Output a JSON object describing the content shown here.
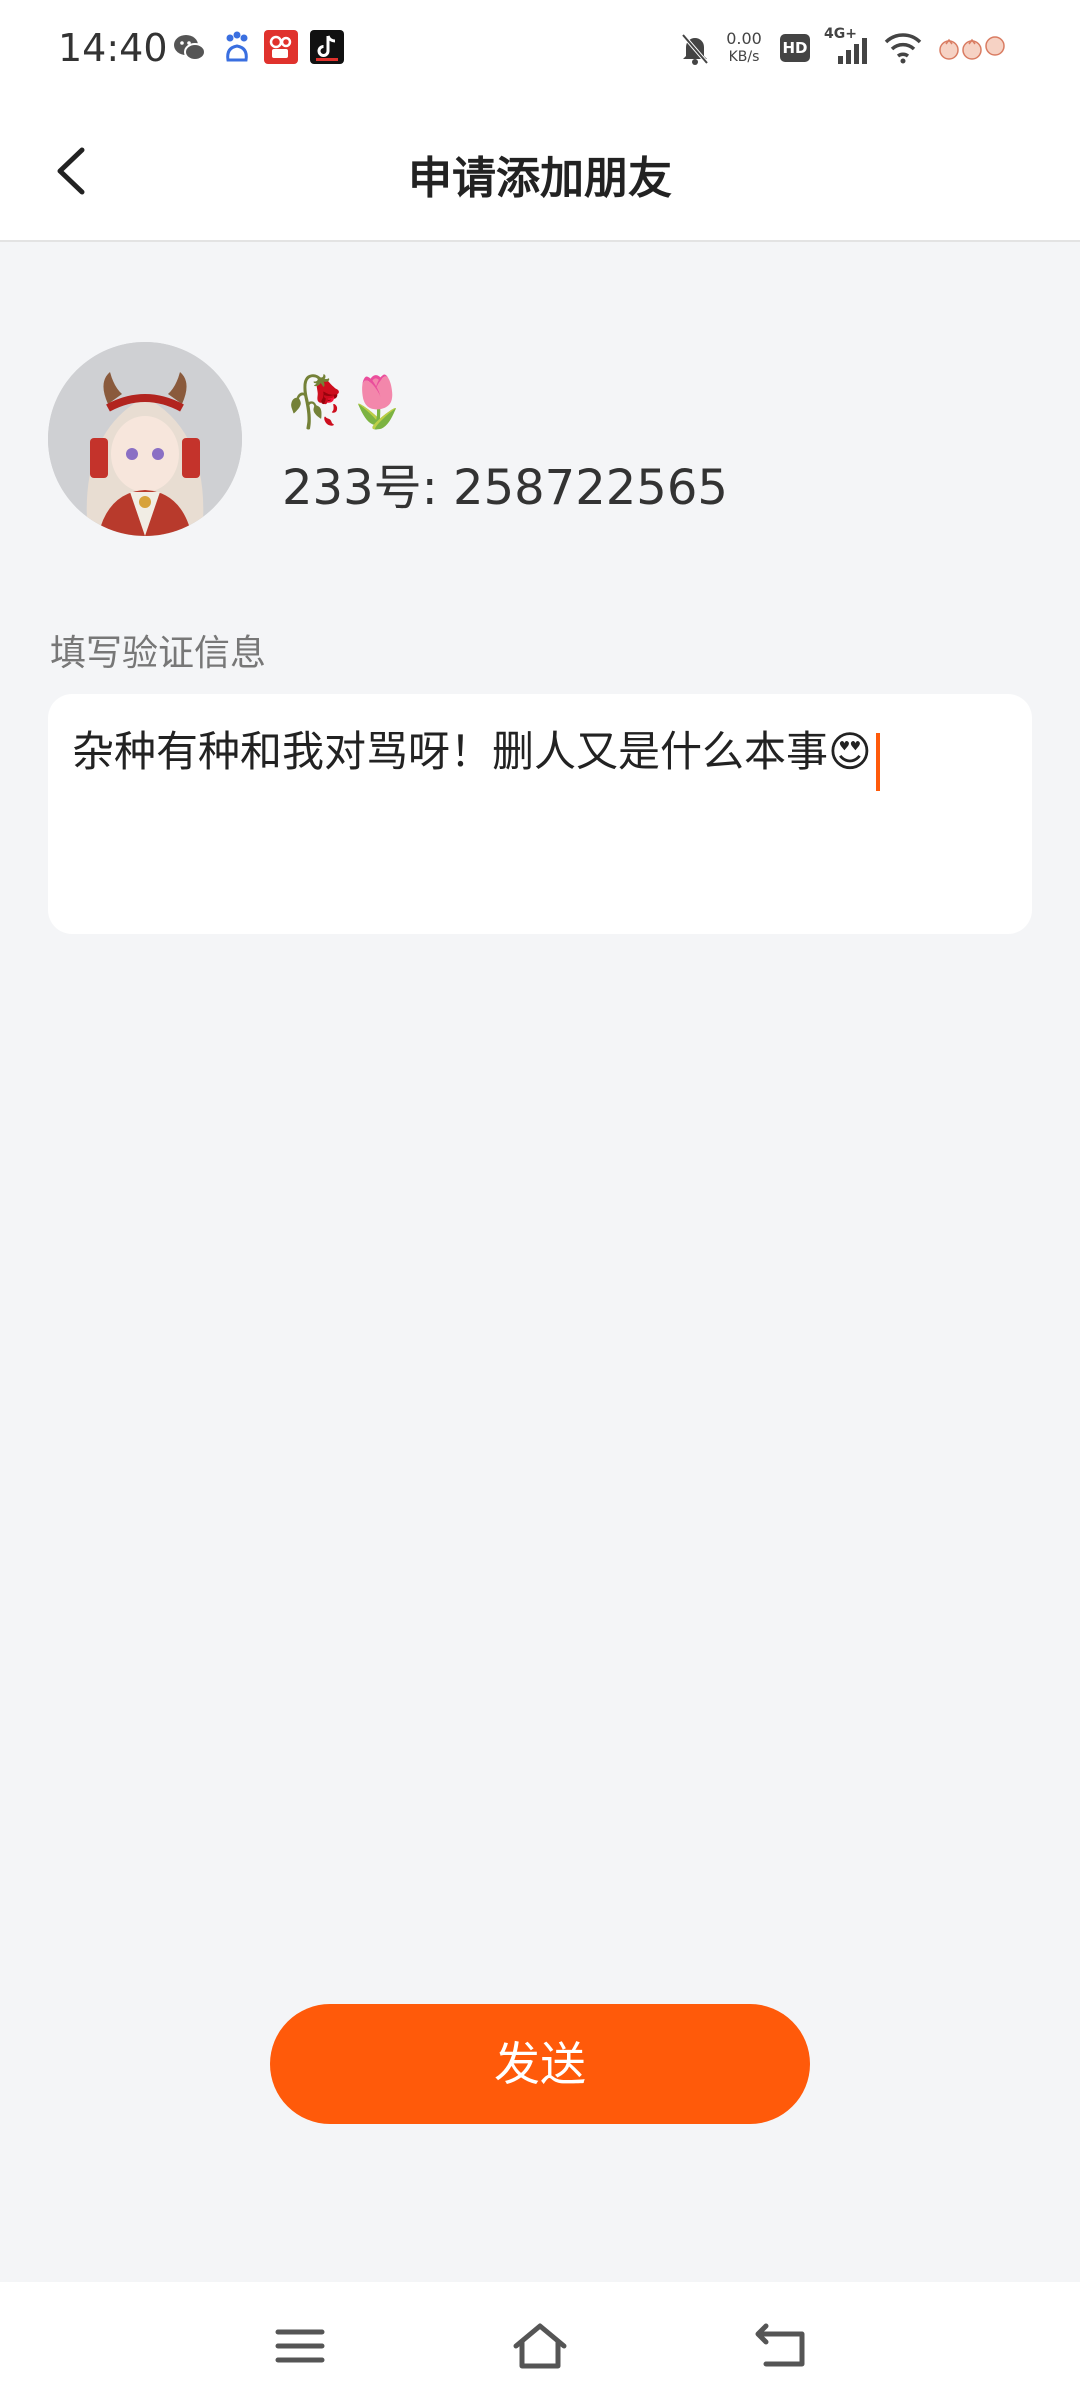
{
  "status_bar": {
    "time": "14:40",
    "net_speed_value": "0.00",
    "net_speed_unit": "KB/s",
    "hd_label": "HD",
    "network_label": "4G+",
    "app_icons": [
      "wechat-icon",
      "baidu-icon",
      "kuaishou-icon",
      "douyin-icon"
    ],
    "status_icons": [
      "mute-icon",
      "net-speed",
      "hd-icon",
      "signal-icon",
      "wifi-icon",
      "battery-icon"
    ]
  },
  "header": {
    "title": "申请添加朋友",
    "back_icon": "chevron-left-icon"
  },
  "profile": {
    "nickname": "🥀🌷",
    "id_text": "233号: 258722565"
  },
  "verification": {
    "label": "填写验证信息",
    "message": "杂种有种和我对骂呀！删人又是什么本事😍"
  },
  "actions": {
    "send_label": "发送"
  },
  "nav_bar": {
    "icons": [
      "menu-icon",
      "home-icon",
      "back-icon"
    ]
  },
  "colors": {
    "accent": "#ff5a0a",
    "background": "#f4f5f7",
    "surface": "#ffffff",
    "text_primary": "#222222",
    "text_secondary": "#777777"
  }
}
